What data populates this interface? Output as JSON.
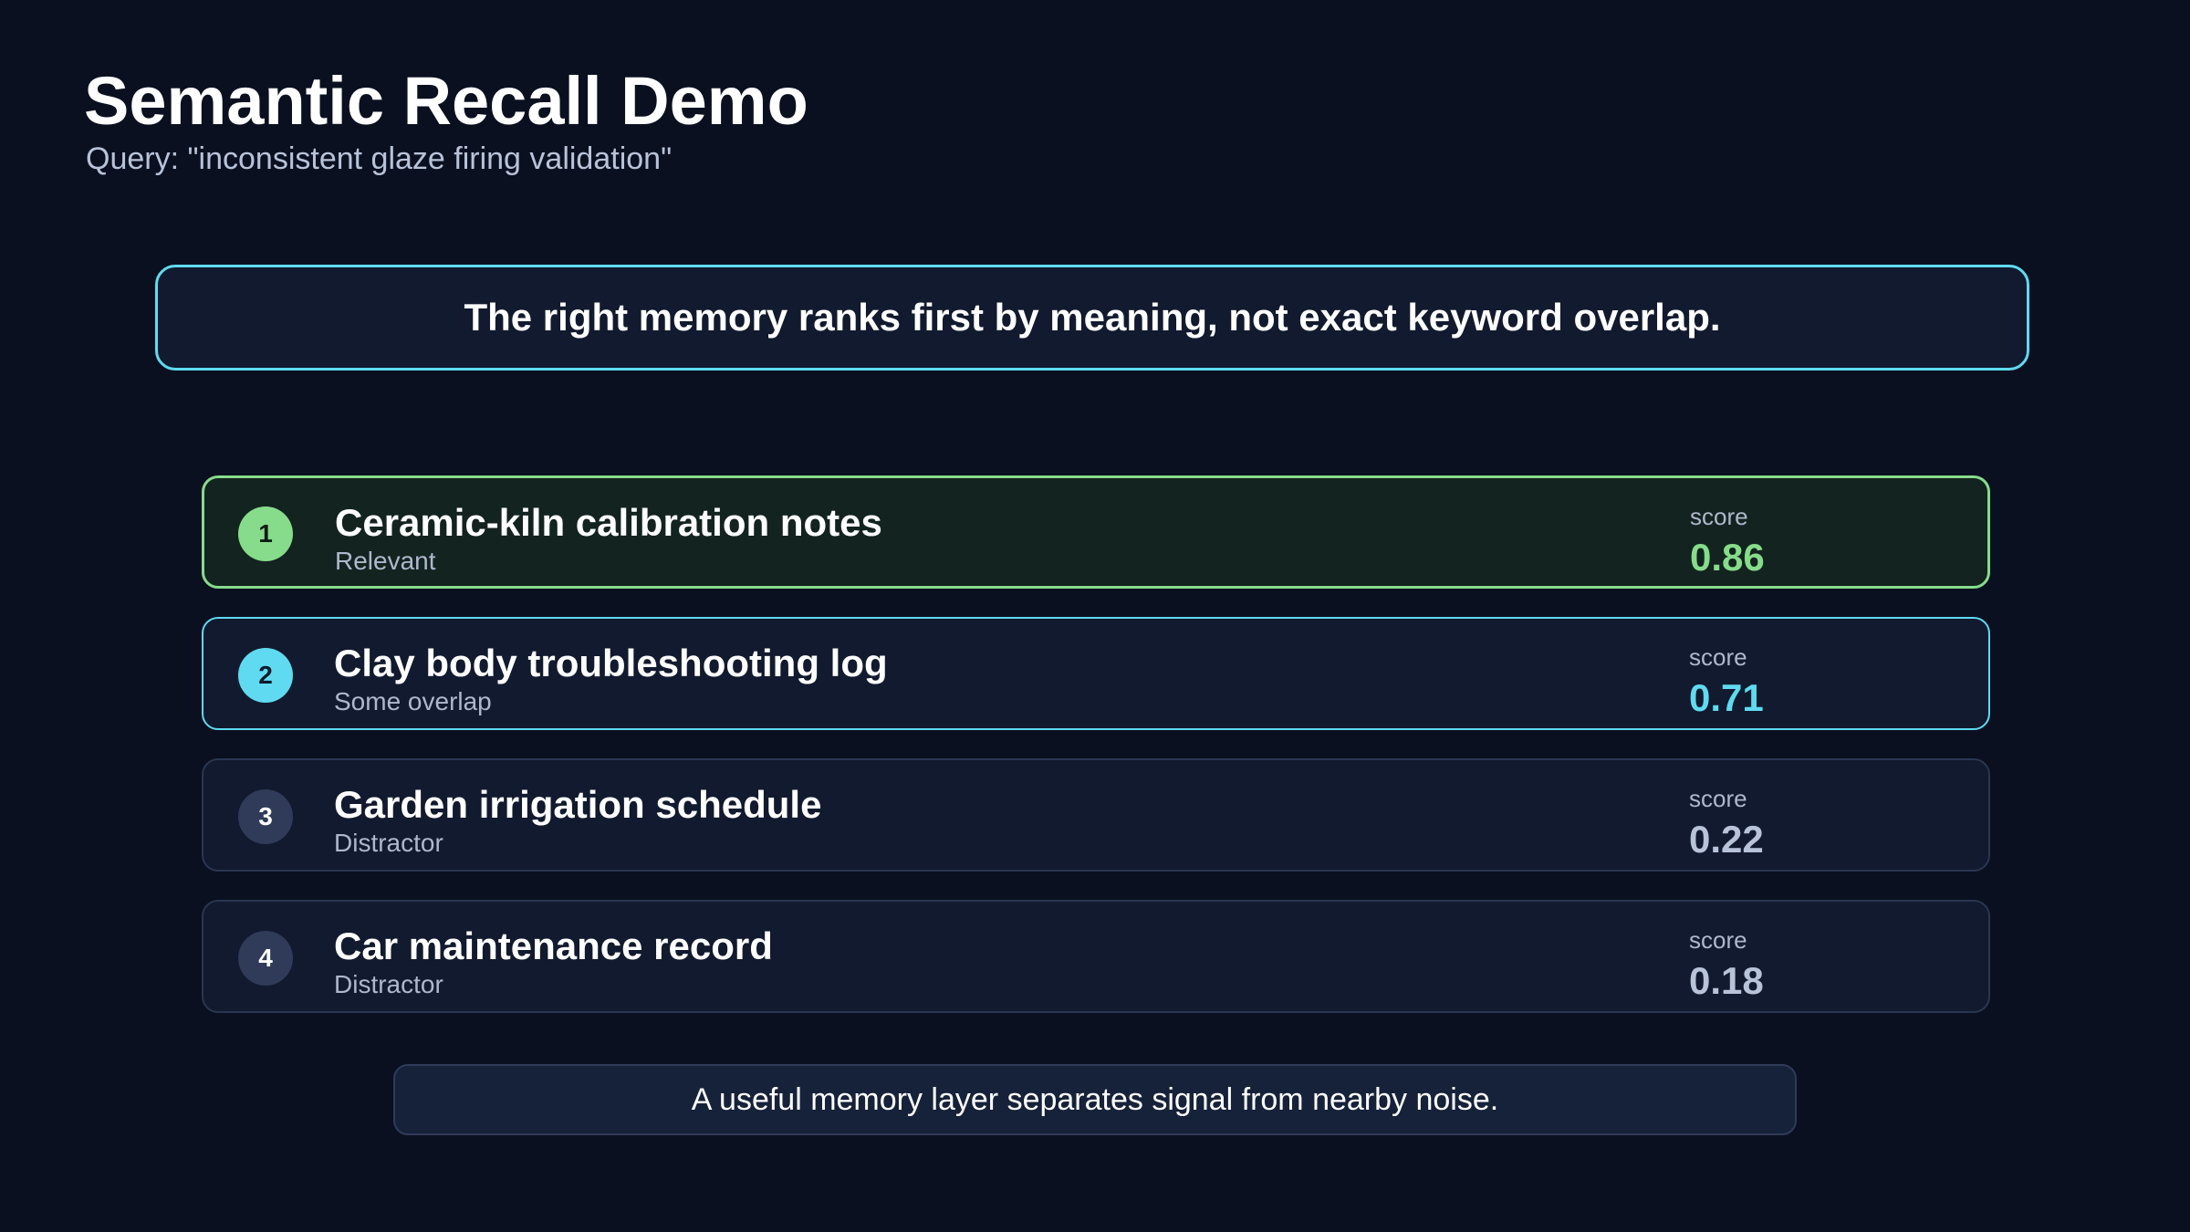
{
  "header": {
    "title": "Semantic Recall Demo",
    "query": "Query: \"inconsistent glaze firing validation\""
  },
  "banner": {
    "text": "The right memory ranks first by meaning, not exact keyword overlap."
  },
  "results": [
    {
      "rank": "1",
      "title": "Ceramic-kiln calibration notes",
      "tag": "Relevant",
      "score_label": "score",
      "score": "0.86"
    },
    {
      "rank": "2",
      "title": "Clay body troubleshooting log",
      "tag": "Some overlap",
      "score_label": "score",
      "score": "0.71"
    },
    {
      "rank": "3",
      "title": "Garden irrigation schedule",
      "tag": "Distractor",
      "score_label": "score",
      "score": "0.22"
    },
    {
      "rank": "4",
      "title": "Car maintenance record",
      "tag": "Distractor",
      "score_label": "score",
      "score": "0.18"
    }
  ],
  "footer": {
    "text": "A useful memory layer separates signal from nearby noise."
  },
  "colors": {
    "background": "#0a1020",
    "relevant": "#86dc8a",
    "overlap": "#5fdaf0",
    "distractor": "#b8c3d9"
  }
}
